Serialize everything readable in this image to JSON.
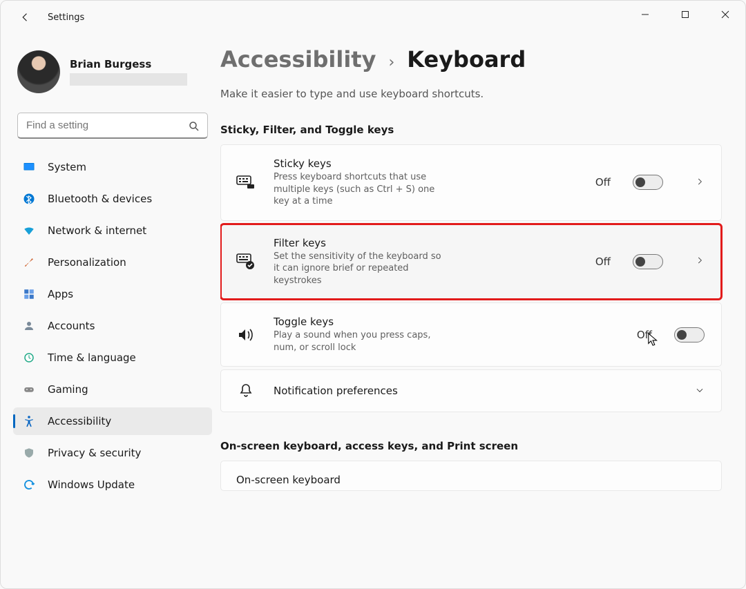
{
  "window": {
    "title": "Settings"
  },
  "profile": {
    "name": "Brian Burgess"
  },
  "search": {
    "placeholder": "Find a setting"
  },
  "sidebar": {
    "items": [
      {
        "label": "System"
      },
      {
        "label": "Bluetooth & devices"
      },
      {
        "label": "Network & internet"
      },
      {
        "label": "Personalization"
      },
      {
        "label": "Apps"
      },
      {
        "label": "Accounts"
      },
      {
        "label": "Time & language"
      },
      {
        "label": "Gaming"
      },
      {
        "label": "Accessibility"
      },
      {
        "label": "Privacy & security"
      },
      {
        "label": "Windows Update"
      }
    ],
    "active_index": 8
  },
  "breadcrumb": {
    "parent": "Accessibility",
    "current": "Keyboard"
  },
  "page_subtitle": "Make it easier to type and use keyboard shortcuts.",
  "sections": {
    "group1": {
      "header": "Sticky, Filter, and Toggle keys",
      "items": [
        {
          "title": "Sticky keys",
          "desc": "Press keyboard shortcuts that use multiple keys (such as Ctrl + S) one key at a time",
          "state": "Off",
          "has_arrow": true
        },
        {
          "title": "Filter keys",
          "desc": "Set the sensitivity of the keyboard so it can ignore brief or repeated keystrokes",
          "state": "Off",
          "has_arrow": true,
          "highlight": true
        },
        {
          "title": "Toggle keys",
          "desc": "Play a sound when you press caps, num, or scroll lock",
          "state": "Off",
          "has_arrow": false
        },
        {
          "title": "Notification preferences",
          "desc": "",
          "expand": true
        }
      ]
    },
    "group2": {
      "header": "On-screen keyboard, access keys, and Print screen",
      "items": [
        {
          "title": "On-screen keyboard"
        }
      ]
    }
  }
}
